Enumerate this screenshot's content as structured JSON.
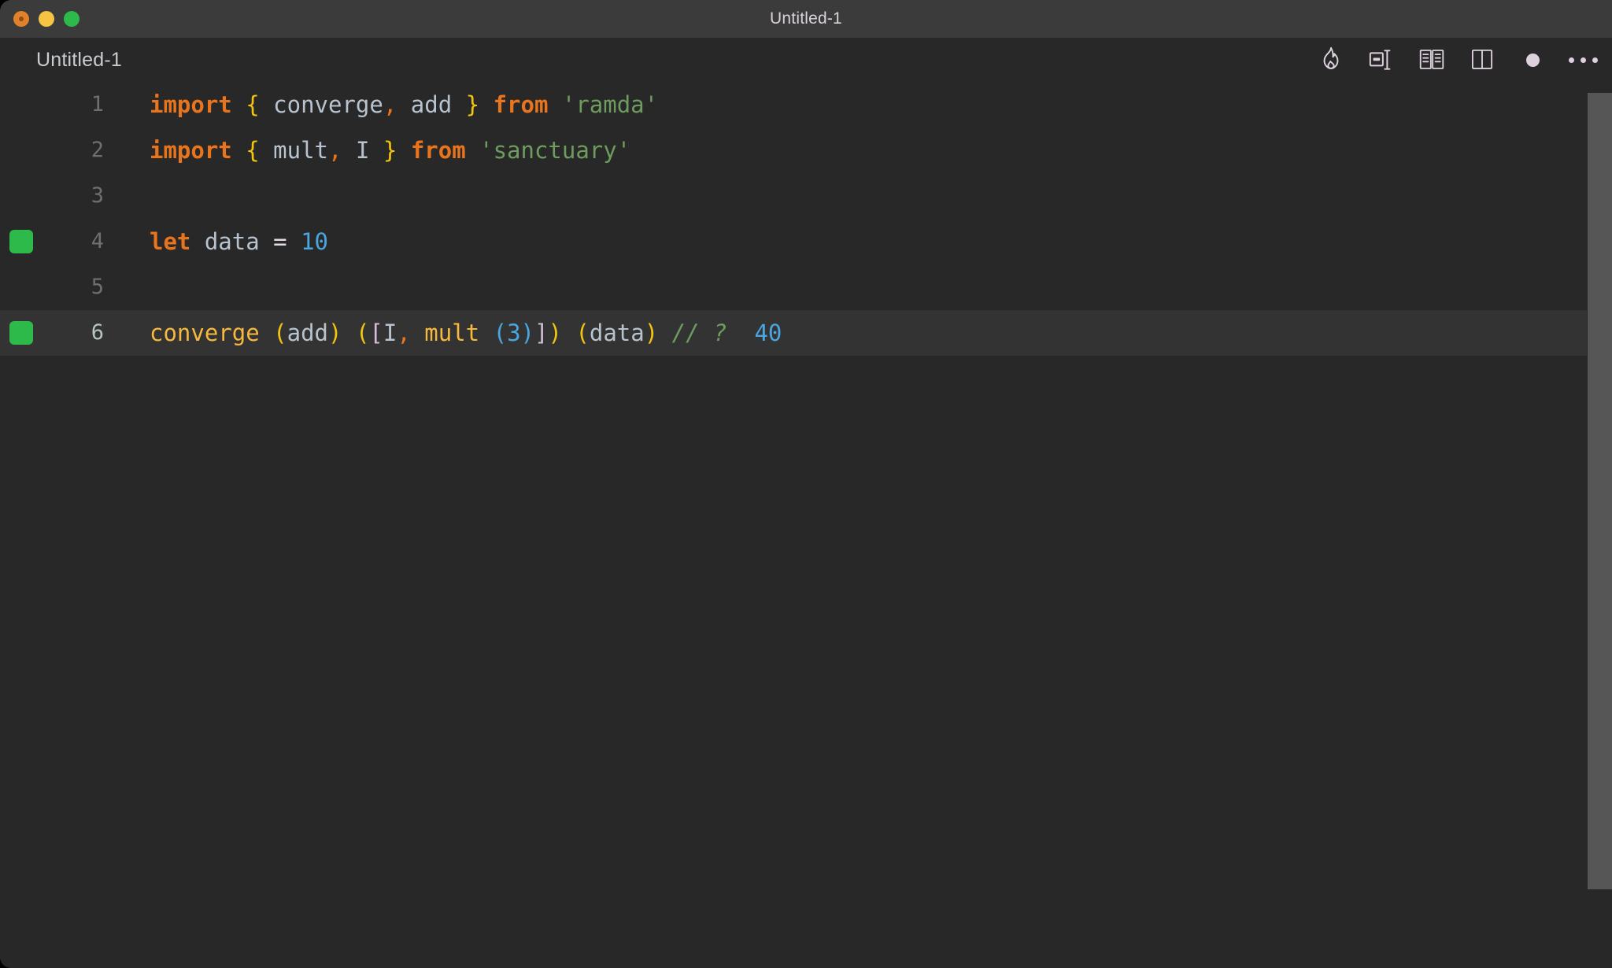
{
  "window": {
    "title": "Untitled-1",
    "traffic_lights": [
      {
        "name": "close",
        "color": "#e2812a"
      },
      {
        "name": "minimize",
        "color": "#f6c343"
      },
      {
        "name": "maximize",
        "color": "#2eb94b"
      }
    ]
  },
  "editor_header": {
    "tab_label": "Untitled-1",
    "toolbar_icons": [
      {
        "name": "flame-icon",
        "label": "Quokka / Run"
      },
      {
        "name": "split-layout-icon",
        "label": "Toggle Layout"
      },
      {
        "name": "book-preview-icon",
        "label": "Open Preview"
      },
      {
        "name": "split-editor-icon",
        "label": "Split Editor"
      },
      {
        "name": "unsaved-dot-icon",
        "label": "Unsaved Changes"
      },
      {
        "name": "ellipsis-icon",
        "label": "More Actions"
      }
    ]
  },
  "code": {
    "language": "javascript",
    "active_line": 6,
    "lines": [
      {
        "number": "1",
        "marker": false,
        "active": false,
        "text": "import { converge, add } from 'ramda'",
        "tokens": [
          {
            "t": "import",
            "c": "t-kw"
          },
          {
            "t": " ",
            "c": "t-ident"
          },
          {
            "t": "{",
            "c": "t-brace"
          },
          {
            "t": " converge",
            "c": "t-ident"
          },
          {
            "t": ",",
            "c": "t-comma"
          },
          {
            "t": " add ",
            "c": "t-ident"
          },
          {
            "t": "}",
            "c": "t-brace"
          },
          {
            "t": " ",
            "c": "t-ident"
          },
          {
            "t": "from",
            "c": "t-kw"
          },
          {
            "t": " ",
            "c": "t-ident"
          },
          {
            "t": "'ramda'",
            "c": "t-str"
          }
        ]
      },
      {
        "number": "2",
        "marker": false,
        "active": false,
        "text": "import { mult, I } from 'sanctuary'",
        "tokens": [
          {
            "t": "import",
            "c": "t-kw"
          },
          {
            "t": " ",
            "c": "t-ident"
          },
          {
            "t": "{",
            "c": "t-brace"
          },
          {
            "t": " mult",
            "c": "t-ident"
          },
          {
            "t": ",",
            "c": "t-comma"
          },
          {
            "t": " I ",
            "c": "t-ident"
          },
          {
            "t": "}",
            "c": "t-brace"
          },
          {
            "t": " ",
            "c": "t-ident"
          },
          {
            "t": "from",
            "c": "t-kw"
          },
          {
            "t": " ",
            "c": "t-ident"
          },
          {
            "t": "'sanctuary'",
            "c": "t-str"
          }
        ]
      },
      {
        "number": "3",
        "marker": false,
        "active": false,
        "text": "",
        "tokens": []
      },
      {
        "number": "4",
        "marker": true,
        "active": false,
        "text": "let data = 10",
        "tokens": [
          {
            "t": "let",
            "c": "t-kw"
          },
          {
            "t": " data ",
            "c": "t-ident"
          },
          {
            "t": "=",
            "c": "t-op"
          },
          {
            "t": " ",
            "c": "t-ident"
          },
          {
            "t": "10",
            "c": "t-num"
          }
        ]
      },
      {
        "number": "5",
        "marker": false,
        "active": false,
        "text": "",
        "tokens": []
      },
      {
        "number": "6",
        "marker": true,
        "active": true,
        "text": "converge (add) ([I, mult (3)]) (data) // ?  40",
        "tokens": [
          {
            "t": "converge",
            "c": "t-fn"
          },
          {
            "t": " ",
            "c": "t-ident"
          },
          {
            "t": "(",
            "c": "t-paren"
          },
          {
            "t": "add",
            "c": "t-ident"
          },
          {
            "t": ")",
            "c": "t-paren"
          },
          {
            "t": " ",
            "c": "t-ident"
          },
          {
            "t": "(",
            "c": "t-paren"
          },
          {
            "t": "[",
            "c": "t-bracket"
          },
          {
            "t": "I",
            "c": "t-ident"
          },
          {
            "t": ",",
            "c": "t-comma"
          },
          {
            "t": " ",
            "c": "t-ident"
          },
          {
            "t": "mult",
            "c": "t-fn"
          },
          {
            "t": " ",
            "c": "t-ident"
          },
          {
            "t": "(",
            "c": "t-paren-b"
          },
          {
            "t": "3",
            "c": "t-num"
          },
          {
            "t": ")",
            "c": "t-paren-b"
          },
          {
            "t": "]",
            "c": "t-bracket"
          },
          {
            "t": ")",
            "c": "t-paren"
          },
          {
            "t": " ",
            "c": "t-ident"
          },
          {
            "t": "(",
            "c": "t-paren"
          },
          {
            "t": "data",
            "c": "t-ident"
          },
          {
            "t": ")",
            "c": "t-paren"
          },
          {
            "t": " ",
            "c": "t-ident"
          },
          {
            "t": "//",
            "c": "t-comment"
          },
          {
            "t": " ",
            "c": "t-ident"
          },
          {
            "t": "?",
            "c": "t-comment"
          },
          {
            "t": "  ",
            "c": "t-ident"
          },
          {
            "t": "40",
            "c": "t-num"
          }
        ]
      }
    ]
  },
  "colors": {
    "titlebar_bg": "#3b3b3b",
    "editor_bg": "#282828",
    "active_line_bg": "#333333",
    "gutter_marker": "#2eb94b",
    "keyword": "#e8741e",
    "string": "#6e9b5e",
    "number": "#4aa6e0",
    "function": "#f6b93b",
    "comment": "#6e9b5e",
    "scrollbar": "#565656"
  }
}
